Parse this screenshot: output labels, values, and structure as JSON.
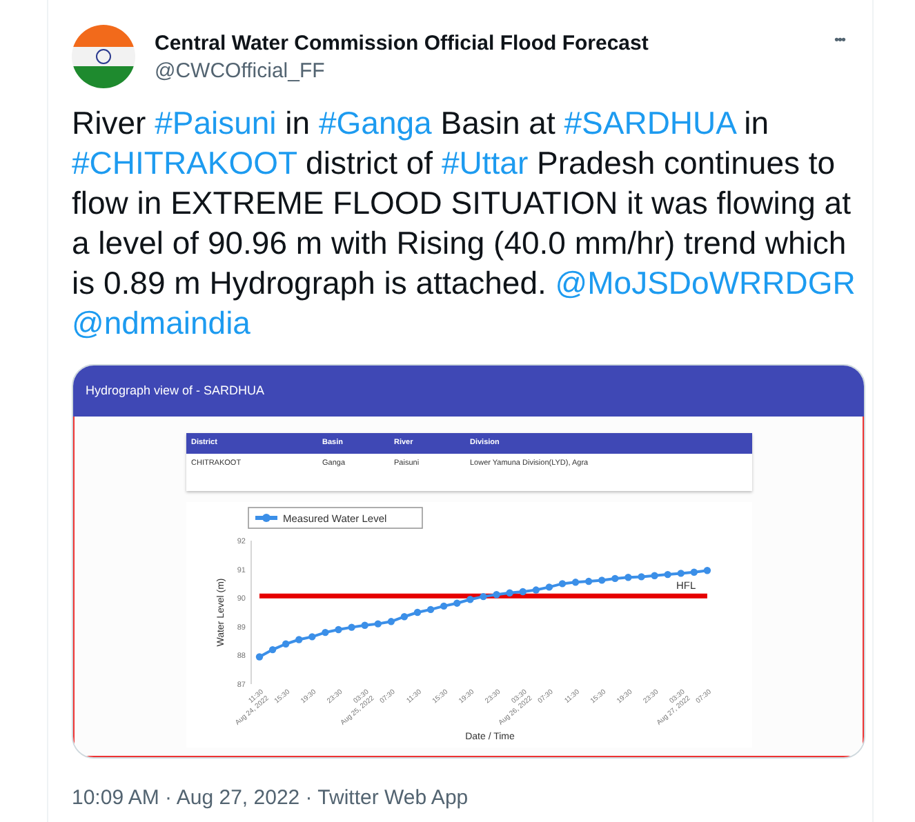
{
  "author": {
    "name": "Central Water Commission Official Flood Forecast",
    "handle": "@CWCOfficial_FF",
    "more": "•••"
  },
  "tweet": [
    {
      "kind": "plain",
      "text": "River "
    },
    {
      "kind": "link",
      "text": "#Paisuni"
    },
    {
      "kind": "plain",
      "text": " in "
    },
    {
      "kind": "link",
      "text": "#Ganga"
    },
    {
      "kind": "plain",
      "text": " Basin at "
    },
    {
      "kind": "link",
      "text": "#SARDHUA"
    },
    {
      "kind": "plain",
      "text": " in "
    },
    {
      "kind": "link",
      "text": "#CHITRAKOOT"
    },
    {
      "kind": "plain",
      "text": " district of "
    },
    {
      "kind": "link",
      "text": "#Uttar"
    },
    {
      "kind": "plain",
      "text": " Pradesh continues to flow in EXTREME FLOOD SITUATION it was flowing at a level of 90.96 m with Rising (40.0 mm/hr) trend which is 0.89 m Hydrograph is attached. "
    },
    {
      "kind": "link",
      "text": "@MoJSDoWRRDGR"
    },
    {
      "kind": "link",
      "text": "@ndmaindia"
    }
  ],
  "attachment": {
    "title": "Hydrograph view of - SARDHUA",
    "table": {
      "columns": [
        "District",
        "Basin",
        "River",
        "Division"
      ],
      "rows": [
        [
          "CHITRAKOOT",
          "Ganga",
          "Paisuni",
          "Lower Yamuna Division(LYD), Agra"
        ]
      ]
    },
    "chart_data": {
      "type": "line",
      "xlabel": "Date / Time",
      "ylabel": "Water Level (m)",
      "categories": [
        "11:30 Aug 24, 2022",
        null,
        "15:30",
        null,
        "19:30",
        null,
        "23:30",
        null,
        "03:30 Aug 25, 2022",
        null,
        "07:30",
        null,
        "11:30",
        null,
        "15:30",
        null,
        "19:30",
        null,
        "23:30",
        null,
        "03:30 Aug 26, 2022",
        null,
        "07:30",
        null,
        "11:30",
        null,
        "15:30",
        null,
        "19:30",
        null,
        "23:30",
        null,
        "03:30 Aug 27, 2022",
        null,
        "07:30"
      ],
      "series": [
        {
          "name": "Measured Water Level",
          "color": "#3b8fe8",
          "marker": "circle",
          "values": [
            87.95,
            88.2,
            88.4,
            88.55,
            88.65,
            88.8,
            88.9,
            88.98,
            89.05,
            89.1,
            89.18,
            89.35,
            89.5,
            89.6,
            89.72,
            89.82,
            89.95,
            90.05,
            90.12,
            90.18,
            90.22,
            90.28,
            90.38,
            90.5,
            90.55,
            90.58,
            90.62,
            90.68,
            90.72,
            90.74,
            90.78,
            90.82,
            90.86,
            90.9,
            90.96
          ]
        },
        {
          "name": "HFL",
          "color": "#e60000",
          "values": [
            90.07,
            90.07,
            90.07,
            90.07,
            90.07,
            90.07,
            90.07,
            90.07,
            90.07,
            90.07,
            90.07,
            90.07,
            90.07,
            90.07,
            90.07,
            90.07,
            90.07,
            90.07,
            90.07,
            90.07,
            90.07,
            90.07,
            90.07,
            90.07,
            90.07,
            90.07,
            90.07,
            90.07,
            90.07,
            90.07,
            90.07,
            90.07,
            90.07,
            90.07,
            90.07
          ]
        }
      ],
      "ylim": [
        87,
        92
      ],
      "yticks": [
        87,
        88,
        89,
        90,
        91,
        92
      ]
    }
  },
  "footer": {
    "time": "10:09 AM · Aug 27, 2022 · Twitter Web App"
  }
}
